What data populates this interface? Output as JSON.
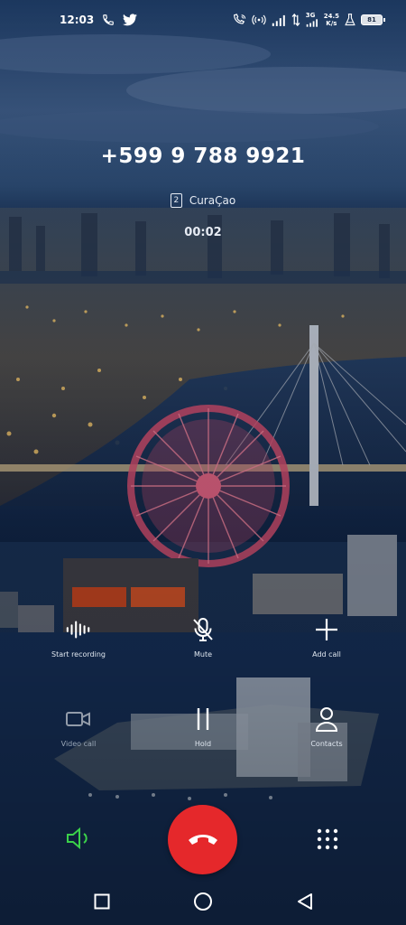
{
  "status_bar": {
    "time": "12:03",
    "left_icons": [
      "phone-icon",
      "twitter-icon"
    ],
    "right_icons": [
      "wifi-call-icon",
      "hotspot-icon",
      "signal-icon",
      "data-arrows-icon",
      "signal-3g-icon"
    ],
    "network_label": "3G",
    "speed_value": "24.5",
    "speed_unit": "K/s",
    "lab_icon": "flask-icon",
    "battery_level": "81"
  },
  "call": {
    "number": "+599 9 788 9921",
    "sim_slot": "2",
    "region": "CuraÇao",
    "duration": "00:02"
  },
  "actions": [
    {
      "label": "Start recording",
      "icon": "waveform-icon",
      "enabled": true
    },
    {
      "label": "Mute",
      "icon": "mic-off-icon",
      "enabled": true
    },
    {
      "label": "Add call",
      "icon": "plus-icon",
      "enabled": true
    },
    {
      "label": "Video call",
      "icon": "video-camera-icon",
      "enabled": false
    },
    {
      "label": "Hold",
      "icon": "pause-icon",
      "enabled": true
    },
    {
      "label": "Contacts",
      "icon": "person-icon",
      "enabled": true
    }
  ],
  "controls": {
    "speaker_icon": "speaker-icon",
    "end_call_icon": "hang-up-icon",
    "keypad_icon": "dialpad-icon",
    "speaker_color": "#3bd14a",
    "end_call_color": "#e5282b"
  },
  "nav_bar": {
    "icons": [
      "recents-square-icon",
      "home-circle-icon",
      "back-triangle-icon"
    ]
  }
}
